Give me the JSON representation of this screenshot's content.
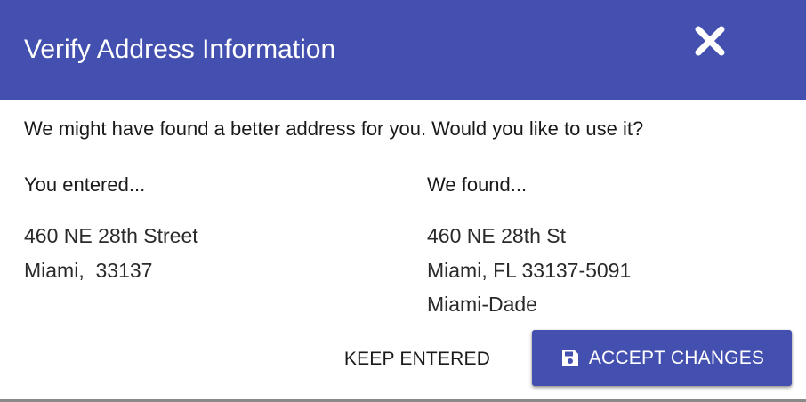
{
  "dialog": {
    "title": "Verify Address Information",
    "message": "We might have found a better address for you. Would you like to use it?"
  },
  "entered": {
    "heading": "You entered...",
    "lines": [
      "460 NE 28th Street",
      "Miami,  33137"
    ]
  },
  "found": {
    "heading": "We found...",
    "lines": [
      "460 NE 28th St",
      "Miami, FL 33137-5091",
      "Miami-Dade"
    ]
  },
  "actions": {
    "keep_label": "KEEP ENTERED",
    "accept_label": "ACCEPT CHANGES"
  },
  "icons": {
    "close": "close-icon",
    "accept": "save-icon"
  },
  "colors": {
    "primary": "#4450b0",
    "on_primary": "#ffffff",
    "text": "#1a1a1a"
  }
}
